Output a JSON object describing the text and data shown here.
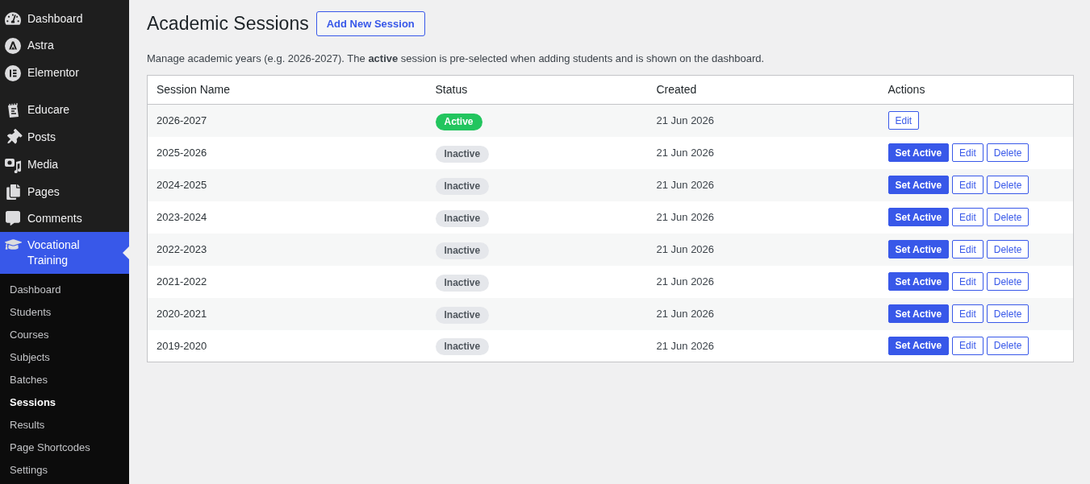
{
  "sidebar": {
    "groups": [
      {
        "items": [
          {
            "label": "Dashboard",
            "selected": false
          },
          {
            "label": "Astra",
            "selected": false
          },
          {
            "label": "Elementor",
            "selected": false
          }
        ]
      },
      {
        "items": [
          {
            "label": "Educare",
            "selected": false
          },
          {
            "label": "Posts",
            "selected": false
          },
          {
            "label": "Media",
            "selected": false
          },
          {
            "label": "Pages",
            "selected": false
          },
          {
            "label": "Comments",
            "selected": false
          },
          {
            "label": "Vocational Training",
            "selected": true
          }
        ]
      }
    ],
    "submenu": [
      {
        "label": "Dashboard",
        "selected": false
      },
      {
        "label": "Students",
        "selected": false
      },
      {
        "label": "Courses",
        "selected": false
      },
      {
        "label": "Subjects",
        "selected": false
      },
      {
        "label": "Batches",
        "selected": false
      },
      {
        "label": "Sessions",
        "selected": true
      },
      {
        "label": "Results",
        "selected": false
      },
      {
        "label": "Page Shortcodes",
        "selected": false
      },
      {
        "label": "Settings",
        "selected": false
      }
    ]
  },
  "header": {
    "title": "Academic Sessions",
    "add_button": "Add New Session"
  },
  "description": "Manage academic years (e.g. 2026-2027). The **active** session is pre-selected when adding students and is shown on the dashboard.",
  "table": {
    "columns": [
      "Session Name",
      "Status",
      "Created",
      "Actions"
    ],
    "rows": [
      {
        "name": "2026-2027",
        "status": {
          "label": "Active",
          "active": true
        },
        "created": "21 Jun 2026",
        "actions": [
          {
            "label": "Edit",
            "kind": "outline"
          }
        ]
      },
      {
        "name": "2025-2026",
        "status": {
          "label": "Inactive",
          "active": false
        },
        "created": "21 Jun 2026",
        "actions": [
          {
            "label": "Set Active",
            "kind": "filled"
          },
          {
            "label": "Edit",
            "kind": "outline"
          },
          {
            "label": "Delete",
            "kind": "outline"
          }
        ]
      },
      {
        "name": "2024-2025",
        "status": {
          "label": "Inactive",
          "active": false
        },
        "created": "21 Jun 2026",
        "actions": [
          {
            "label": "Set Active",
            "kind": "filled"
          },
          {
            "label": "Edit",
            "kind": "outline"
          },
          {
            "label": "Delete",
            "kind": "outline"
          }
        ]
      },
      {
        "name": "2023-2024",
        "status": {
          "label": "Inactive",
          "active": false
        },
        "created": "21 Jun 2026",
        "actions": [
          {
            "label": "Set Active",
            "kind": "filled"
          },
          {
            "label": "Edit",
            "kind": "outline"
          },
          {
            "label": "Delete",
            "kind": "outline"
          }
        ]
      },
      {
        "name": "2022-2023",
        "status": {
          "label": "Inactive",
          "active": false
        },
        "created": "21 Jun 2026",
        "actions": [
          {
            "label": "Set Active",
            "kind": "filled"
          },
          {
            "label": "Edit",
            "kind": "outline"
          },
          {
            "label": "Delete",
            "kind": "outline"
          }
        ]
      },
      {
        "name": "2021-2022",
        "status": {
          "label": "Inactive",
          "active": false
        },
        "created": "21 Jun 2026",
        "actions": [
          {
            "label": "Set Active",
            "kind": "filled"
          },
          {
            "label": "Edit",
            "kind": "outline"
          },
          {
            "label": "Delete",
            "kind": "outline"
          }
        ]
      },
      {
        "name": "2020-2021",
        "status": {
          "label": "Inactive",
          "active": false
        },
        "created": "21 Jun 2026",
        "actions": [
          {
            "label": "Set Active",
            "kind": "filled"
          },
          {
            "label": "Edit",
            "kind": "outline"
          },
          {
            "label": "Delete",
            "kind": "outline"
          }
        ]
      },
      {
        "name": "2019-2020",
        "status": {
          "label": "Inactive",
          "active": false
        },
        "created": "21 Jun 2026",
        "actions": [
          {
            "label": "Set Active",
            "kind": "filled"
          },
          {
            "label": "Edit",
            "kind": "outline"
          },
          {
            "label": "Delete",
            "kind": "outline"
          }
        ]
      }
    ]
  }
}
